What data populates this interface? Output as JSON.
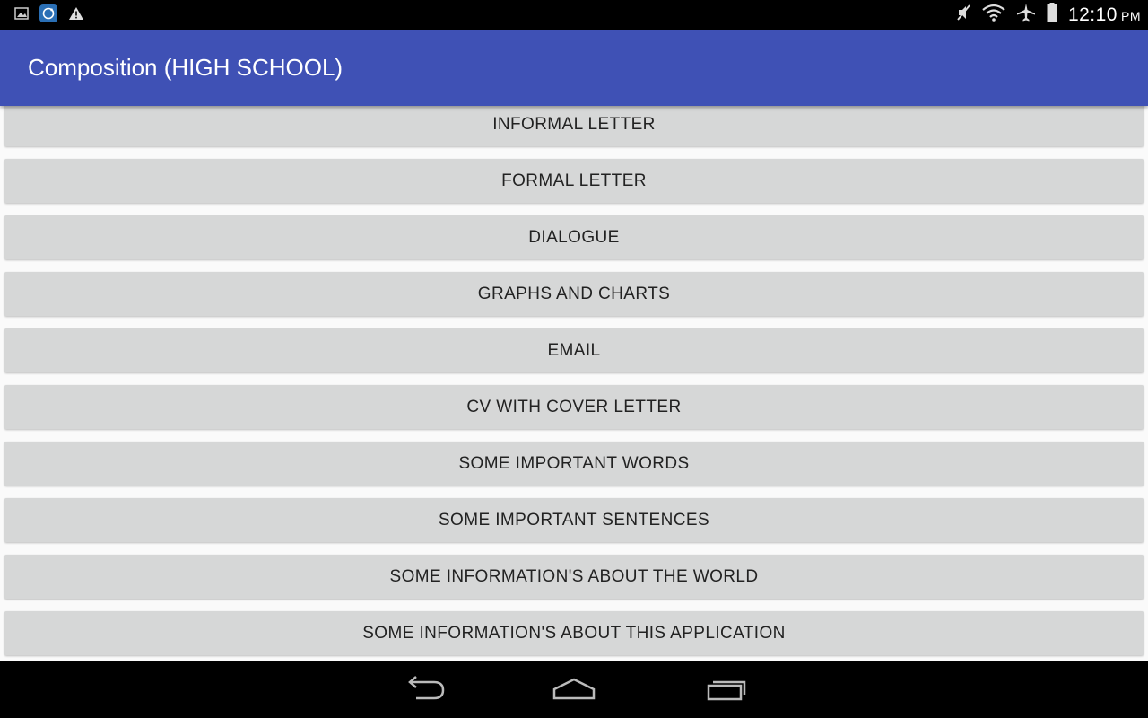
{
  "status_bar": {
    "time": "12:10",
    "ampm": "PM",
    "left_icons": [
      "image-notification-icon",
      "sync-app-icon",
      "warning-icon"
    ],
    "right_icons": [
      "mute-icon",
      "wifi-icon",
      "airplane-mode-icon",
      "battery-icon"
    ]
  },
  "app_bar": {
    "title": "Composition (HIGH SCHOOL)",
    "color": "#3f51b5"
  },
  "menu": {
    "items": [
      {
        "label": "INFORMAL LETTER"
      },
      {
        "label": "FORMAL LETTER"
      },
      {
        "label": "DIALOGUE"
      },
      {
        "label": "GRAPHS AND CHARTS"
      },
      {
        "label": "EMAIL"
      },
      {
        "label": "CV WITH COVER LETTER"
      },
      {
        "label": "SOME IMPORTANT WORDS"
      },
      {
        "label": "SOME IMPORTANT SENTENCES"
      },
      {
        "label": "SOME INFORMATION'S ABOUT THE WORLD"
      },
      {
        "label": "SOME INFORMATION'S ABOUT THIS APPLICATION"
      }
    ]
  },
  "nav_bar": {
    "buttons": [
      "back-icon",
      "home-icon",
      "recent-apps-icon"
    ]
  }
}
